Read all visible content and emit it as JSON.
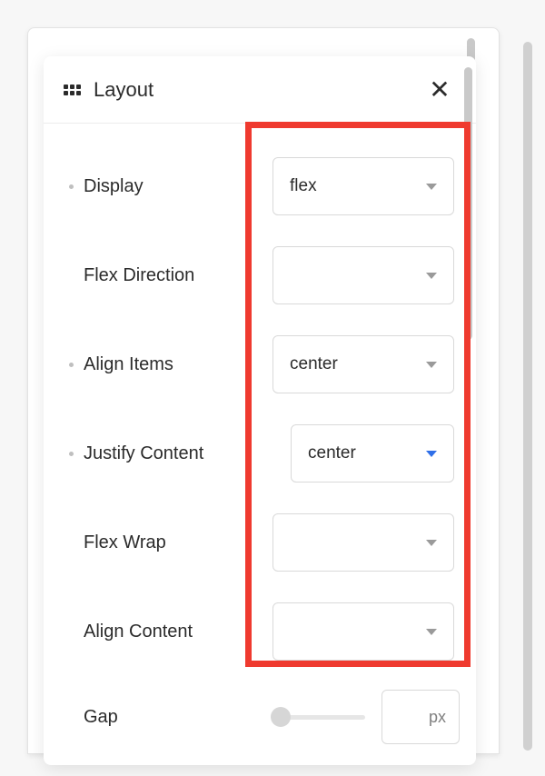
{
  "panel": {
    "title": "Layout"
  },
  "fields": {
    "display": {
      "label": "Display",
      "value": "flex",
      "has_dot": true,
      "caret": "gray"
    },
    "flexDirection": {
      "label": "Flex Direction",
      "value": "",
      "has_dot": false,
      "caret": "gray"
    },
    "alignItems": {
      "label": "Align Items",
      "value": "center",
      "has_dot": true,
      "caret": "gray"
    },
    "justifyContent": {
      "label": "Justify Content",
      "value": "center",
      "has_dot": true,
      "caret": "blue",
      "narrow": true
    },
    "flexWrap": {
      "label": "Flex Wrap",
      "value": "",
      "has_dot": false,
      "caret": "gray"
    },
    "alignContent": {
      "label": "Align Content",
      "value": "",
      "has_dot": false,
      "caret": "gray"
    }
  },
  "gap": {
    "label": "Gap",
    "unit": "px"
  }
}
